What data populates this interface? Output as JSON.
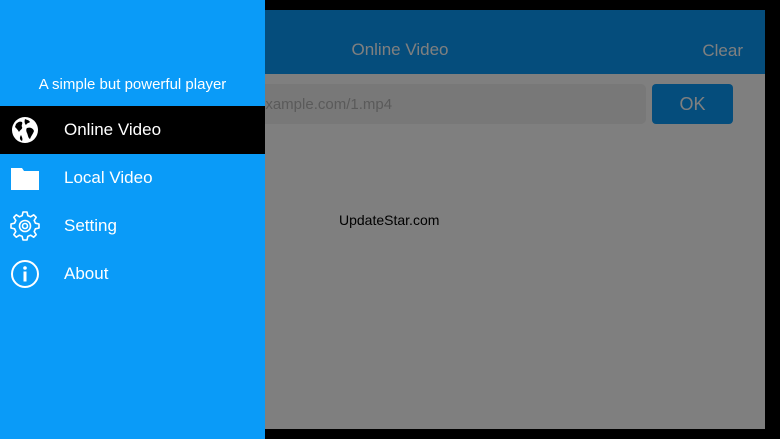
{
  "app": {
    "nav_title": "Online Video",
    "clear_label": "Clear",
    "url_placeholder": "example.com/1.mp4",
    "ok_label": "OK",
    "watermark": "UpdateStar.com"
  },
  "drawer": {
    "tagline": "A simple but powerful player",
    "items": [
      {
        "label": "Online Video",
        "icon": "globe-icon",
        "active": true
      },
      {
        "label": "Local Video",
        "icon": "folder-icon",
        "active": false
      },
      {
        "label": "Setting",
        "icon": "gear-icon",
        "active": false
      },
      {
        "label": "About",
        "icon": "info-icon",
        "active": false
      }
    ]
  },
  "colors": {
    "accent": "#0a9bf8",
    "active_item": "#000000",
    "text_on_accent": "#ffffff"
  }
}
